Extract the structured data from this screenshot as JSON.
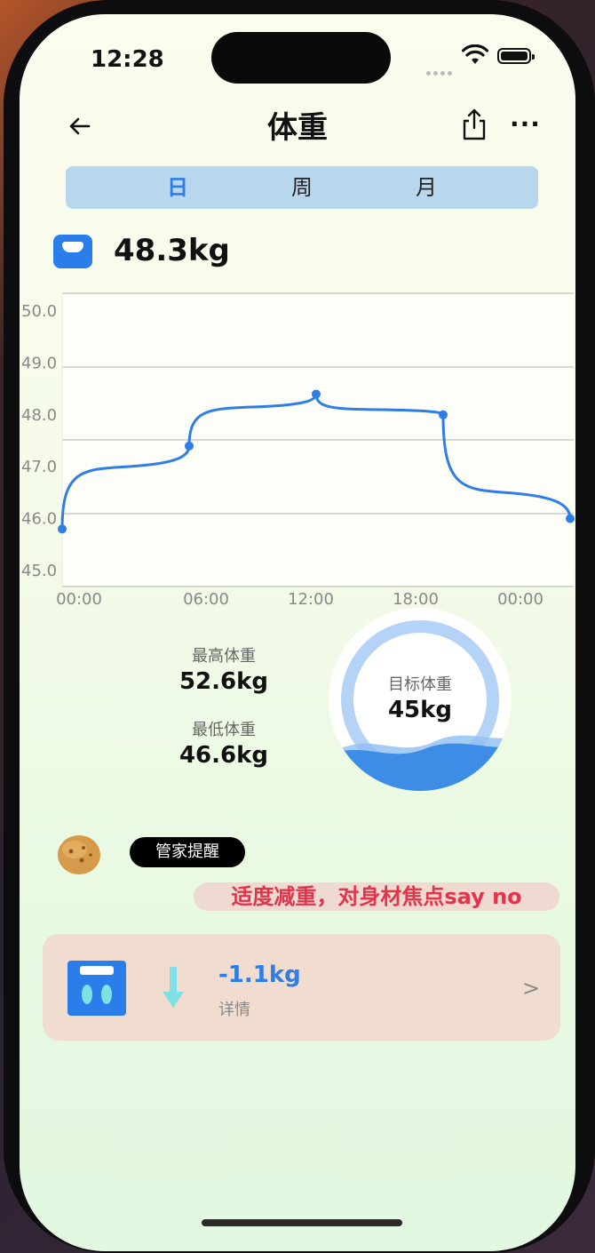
{
  "status_bar": {
    "time": "12:28"
  },
  "header": {
    "title": "体重"
  },
  "tabs": [
    {
      "label": "日",
      "active": true
    },
    {
      "label": "周",
      "active": false
    },
    {
      "label": "月",
      "active": false
    }
  ],
  "current_weight": "48.3kg",
  "chart_data": {
    "type": "line",
    "x_ticks": [
      "00:00",
      "06:00",
      "12:00",
      "18:00",
      "00:00"
    ],
    "y_ticks": [
      "50.0",
      "49.0",
      "48.0",
      "47.0",
      "46.0",
      "45.0"
    ],
    "ylim": [
      45.0,
      50.0
    ],
    "series": [
      {
        "x": [
          0,
          6,
          12,
          18,
          24
        ],
        "y": [
          45.8,
          47.4,
          48.4,
          48.0,
          46.0
        ]
      }
    ],
    "line_color": "#2f7de6"
  },
  "stats": {
    "max_label": "最高体重",
    "max_value": "52.6kg",
    "min_label": "最低体重",
    "min_value": "46.6kg"
  },
  "goal": {
    "label": "目标体重",
    "value": "45kg"
  },
  "assistant": {
    "tag": "管家提醒",
    "advice": "适度减重，对身材焦点say no"
  },
  "summary_card": {
    "delta": "-1.1kg",
    "detail_label": "详情",
    "chevron": ">"
  },
  "colors": {
    "accent": "#2f7de6",
    "advice_text": "#e2354c",
    "tab_bar": "#b8d7ec",
    "card_bg": "#f0ddd0"
  }
}
